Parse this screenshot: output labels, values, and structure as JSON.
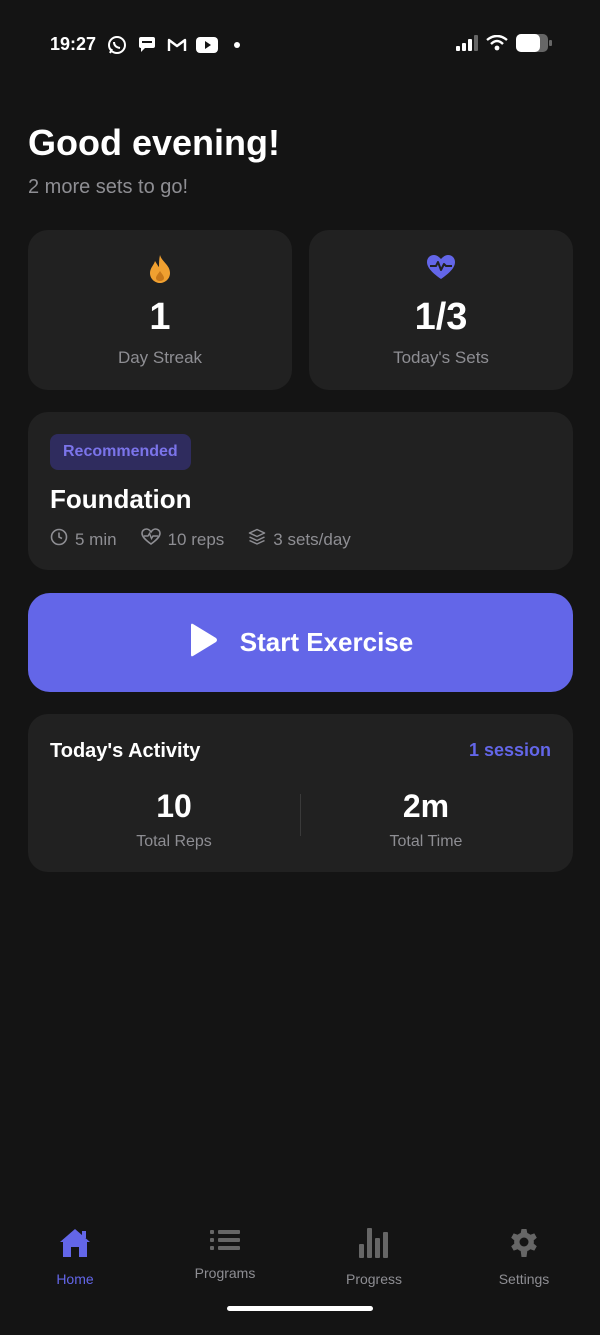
{
  "status_bar": {
    "time": "19:27",
    "left_icons": [
      "whatsapp-icon",
      "chat-bubble-icon",
      "gmail-icon",
      "youtube-icon",
      "dot-icon"
    ],
    "right_icons": [
      "signal-icon",
      "wifi-icon",
      "battery-icon"
    ]
  },
  "header": {
    "greeting": "Good evening!",
    "subtitle": "2 more sets to go!"
  },
  "stats": [
    {
      "icon": "flame-icon",
      "value": "1",
      "label": "Day Streak",
      "color": "#f0a030"
    },
    {
      "icon": "heart-pulse-icon",
      "value": "1/3",
      "label": "Today's Sets",
      "color": "#6366e8"
    }
  ],
  "program": {
    "badge": "Recommended",
    "title": "Foundation",
    "meta": [
      {
        "icon": "clock-icon",
        "text": "5 min"
      },
      {
        "icon": "heartbeat-icon",
        "text": "10 reps"
      },
      {
        "icon": "layers-icon",
        "text": "3 sets/day"
      }
    ]
  },
  "start_button": {
    "label": "Start Exercise",
    "color": "#6366e8"
  },
  "activity": {
    "title": "Today's Activity",
    "session": "1 session",
    "stats": [
      {
        "value": "10",
        "label": "Total Reps"
      },
      {
        "value": "2m",
        "label": "Total Time"
      }
    ]
  },
  "nav": {
    "items": [
      {
        "icon": "home-icon",
        "label": "Home",
        "active": true
      },
      {
        "icon": "list-icon",
        "label": "Programs",
        "active": false
      },
      {
        "icon": "bar-chart-icon",
        "label": "Progress",
        "active": false
      },
      {
        "icon": "gear-icon",
        "label": "Settings",
        "active": false
      }
    ]
  },
  "colors": {
    "accent": "#6366e8",
    "background": "#141414",
    "card": "#212121",
    "muted_text": "#8e8e93"
  }
}
